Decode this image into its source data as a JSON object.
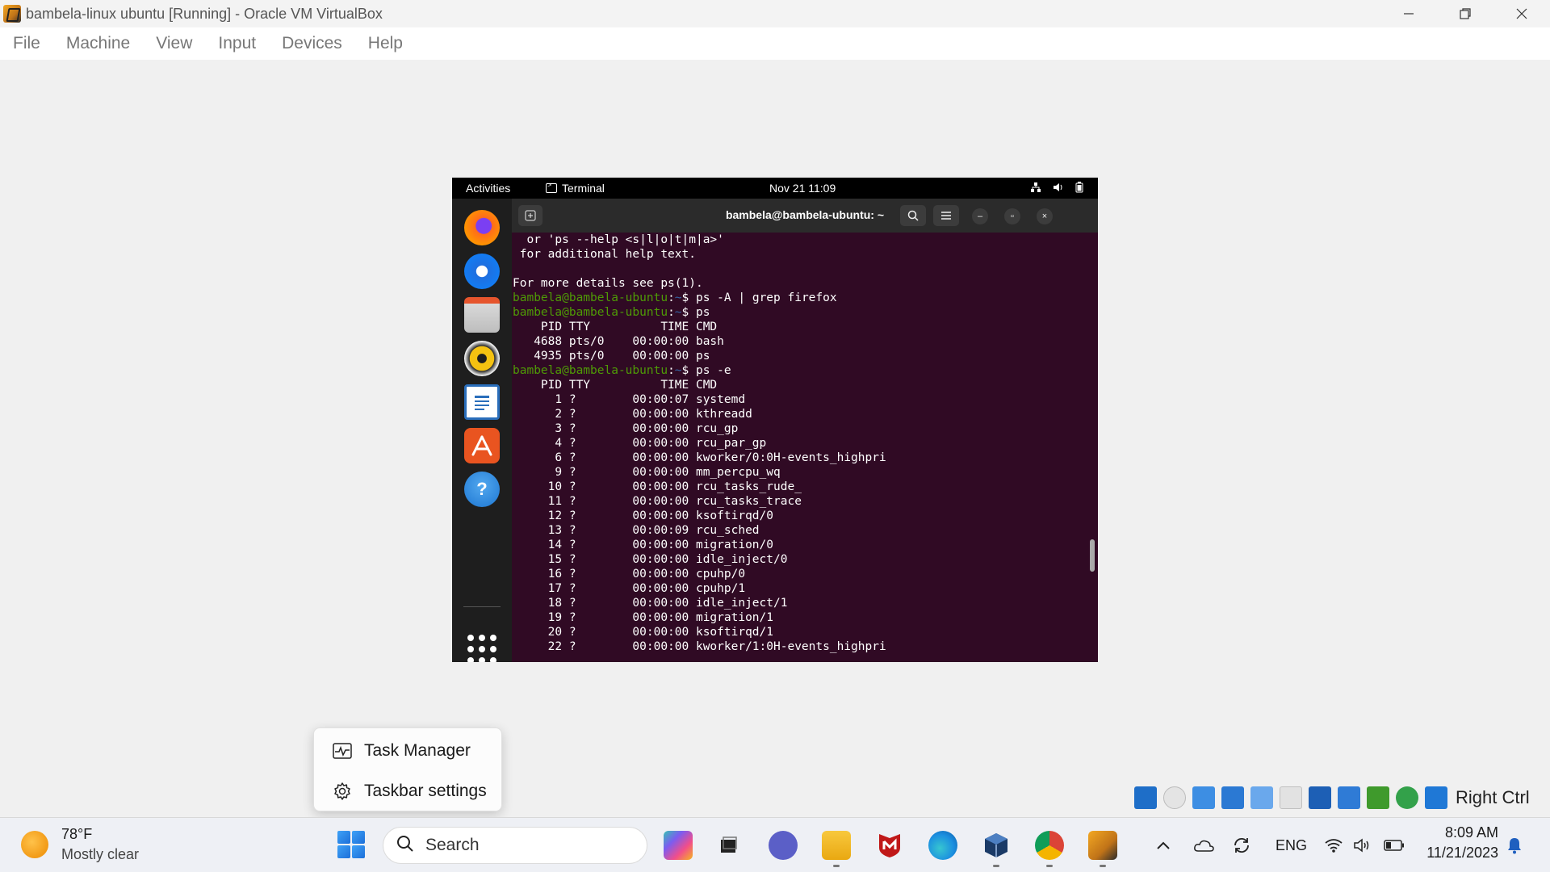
{
  "window": {
    "title": "bambela-linux ubuntu [Running] - Oracle VM VirtualBox",
    "controls": [
      "minimize-icon",
      "restore-icon",
      "close-icon"
    ]
  },
  "menubar": {
    "items": [
      "File",
      "Machine",
      "View",
      "Input",
      "Devices",
      "Help"
    ]
  },
  "gnome": {
    "activities": "Activities",
    "app_label": "Terminal",
    "clock": "Nov 21  11:09",
    "status_icons": [
      "network-icon",
      "volume-icon",
      "battery-icon"
    ]
  },
  "dock": {
    "apps": [
      "firefox-icon",
      "thunderbird-icon",
      "files-icon",
      "rhythmbox-icon",
      "libreoffice-writer-icon",
      "app-center-icon",
      "help-icon",
      "show-apps-icon"
    ]
  },
  "terminal": {
    "title": "bambela@bambela-ubuntu: ~",
    "prompt_user": "bambela@bambela-ubuntu",
    "prompt_path": "~",
    "lines": [
      {
        "text": "  or 'ps --help <s|l|o|t|m|a>'"
      },
      {
        "text": " for additional help text."
      },
      {
        "text": ""
      },
      {
        "text": "For more details see ps(1)."
      },
      {
        "prompt": true,
        "cmd": " ps -A | grep firefox"
      },
      {
        "prompt": true,
        "cmd": " ps"
      },
      {
        "text": "    PID TTY          TIME CMD"
      },
      {
        "text": "   4688 pts/0    00:00:00 bash"
      },
      {
        "text": "   4935 pts/0    00:00:00 ps"
      },
      {
        "prompt": true,
        "cmd": " ps -e"
      },
      {
        "text": "    PID TTY          TIME CMD"
      },
      {
        "text": "      1 ?        00:00:07 systemd"
      },
      {
        "text": "      2 ?        00:00:00 kthreadd"
      },
      {
        "text": "      3 ?        00:00:00 rcu_gp"
      },
      {
        "text": "      4 ?        00:00:00 rcu_par_gp"
      },
      {
        "text": "      6 ?        00:00:00 kworker/0:0H-events_highpri"
      },
      {
        "text": "      9 ?        00:00:00 mm_percpu_wq"
      },
      {
        "text": "     10 ?        00:00:00 rcu_tasks_rude_"
      },
      {
        "text": "     11 ?        00:00:00 rcu_tasks_trace"
      },
      {
        "text": "     12 ?        00:00:00 ksoftirqd/0"
      },
      {
        "text": "     13 ?        00:00:09 rcu_sched"
      },
      {
        "text": "     14 ?        00:00:00 migration/0"
      },
      {
        "text": "     15 ?        00:00:00 idle_inject/0"
      },
      {
        "text": "     16 ?        00:00:00 cpuhp/0"
      },
      {
        "text": "     17 ?        00:00:00 cpuhp/1"
      },
      {
        "text": "     18 ?        00:00:00 idle_inject/1"
      },
      {
        "text": "     19 ?        00:00:00 migration/1"
      },
      {
        "text": "     20 ?        00:00:00 ksoftirqd/1"
      },
      {
        "text": "     22 ?        00:00:00 kworker/1:0H-events_highpri"
      }
    ]
  },
  "context_menu": {
    "items": [
      {
        "label": "Task Manager",
        "icon": "task-manager-icon"
      },
      {
        "label": "Taskbar settings",
        "icon": "gear-icon"
      }
    ]
  },
  "vbox_status": {
    "right_ctrl": "Right Ctrl"
  },
  "taskbar": {
    "weather": {
      "temp": "78°F",
      "condition": "Mostly clear"
    },
    "search_placeholder": "Search",
    "apps": [
      "copilot-pre-icon",
      "task-view-icon",
      "teams-chat-icon",
      "file-explorer-icon",
      "mcafee-icon",
      "edge-icon",
      "virtualbox-icon",
      "chrome-icon",
      "virtualbox-vm-icon"
    ],
    "tray": {
      "language": "ENG",
      "time": "8:09 AM",
      "date": "11/21/2023"
    }
  },
  "colors": {
    "terminal_bg": "#300a24",
    "prompt_green": "#4e9a06",
    "path_blue": "#3465a4",
    "gnome_bar": "#000000",
    "dock_bg": "#1e1e1e"
  }
}
